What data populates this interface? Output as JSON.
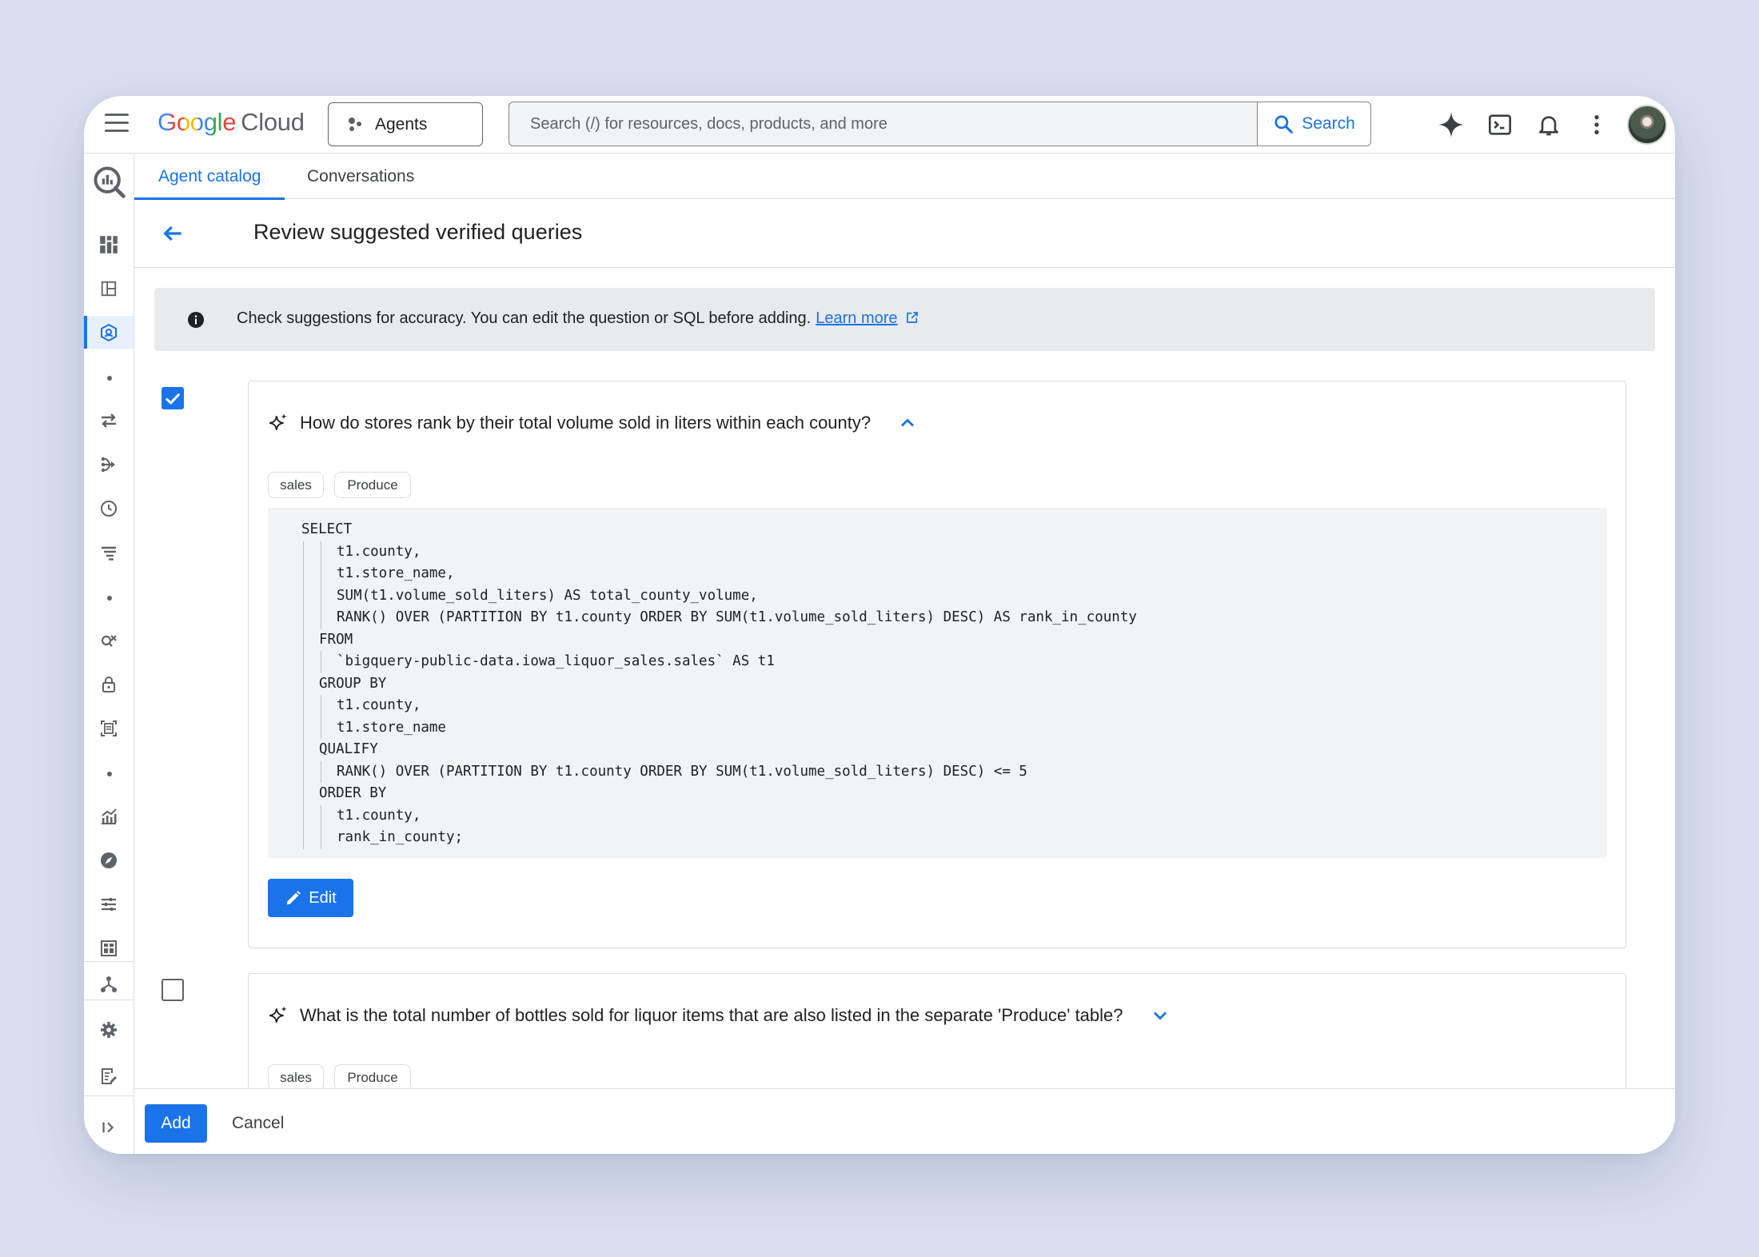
{
  "header": {
    "logo_google": "Google",
    "logo_cloud": "Cloud",
    "agents_label": "Agents",
    "search_placeholder": "Search (/) for resources, docs, products, and more",
    "search_button": "Search"
  },
  "tabs": [
    {
      "label": "Agent catalog",
      "active": true
    },
    {
      "label": "Conversations",
      "active": false
    }
  ],
  "page": {
    "title": "Review suggested verified queries"
  },
  "info": {
    "text": "Check suggestions for accuracy. You can edit the question or SQL before adding.",
    "link": "Learn more"
  },
  "queries": [
    {
      "checked": true,
      "expanded": true,
      "question": "How do stores rank by their total volume sold in liters within each county?",
      "tags": [
        "sales",
        "Produce"
      ],
      "sql": [
        {
          "indent": 0,
          "text": "SELECT"
        },
        {
          "indent": 2,
          "text": "t1.county,"
        },
        {
          "indent": 2,
          "text": "t1.store_name,"
        },
        {
          "indent": 2,
          "text": "SUM(t1.volume_sold_liters) AS total_county_volume,"
        },
        {
          "indent": 2,
          "text": "RANK() OVER (PARTITION BY t1.county ORDER BY SUM(t1.volume_sold_liters) DESC) AS rank_in_county"
        },
        {
          "indent": 1,
          "text": "FROM"
        },
        {
          "indent": 2,
          "text": "`bigquery-public-data.iowa_liquor_sales.sales` AS t1"
        },
        {
          "indent": 1,
          "text": "GROUP BY"
        },
        {
          "indent": 2,
          "text": "t1.county,"
        },
        {
          "indent": 2,
          "text": "t1.store_name"
        },
        {
          "indent": 1,
          "text": "QUALIFY"
        },
        {
          "indent": 2,
          "text": "RANK() OVER (PARTITION BY t1.county ORDER BY SUM(t1.volume_sold_liters) DESC) <= 5"
        },
        {
          "indent": 1,
          "text": "ORDER BY"
        },
        {
          "indent": 2,
          "text": "t1.county,"
        },
        {
          "indent": 2,
          "text": "rank_in_county;"
        }
      ],
      "edit_label": "Edit"
    },
    {
      "checked": false,
      "expanded": false,
      "question": "What is the total number of bottles sold for liquor items that are also listed in the separate 'Produce' table?",
      "tags": [
        "sales",
        "Produce"
      ]
    }
  ],
  "footer": {
    "add_label": "Add",
    "cancel_label": "Cancel"
  },
  "colors": {
    "accent": "#1a73e8",
    "background": "#d9dff0",
    "info_bar": "#e8eaed",
    "code_bg": "#f1f3f4"
  },
  "icons": {
    "rail": [
      "bigquery-logo-icon",
      "dashboard-icon",
      "layout-icon",
      "agent-hexagon-icon",
      "transfer-icon",
      "pipeline-icon",
      "history-icon",
      "filter-list-icon",
      "data-search-icon",
      "lock-icon",
      "document-scan-icon",
      "analytics-icon",
      "explore-icon",
      "tune-icon",
      "table-icon",
      "hierarchy-icon",
      "settings-icon",
      "release-notes-icon",
      "expand-rail-icon"
    ]
  }
}
